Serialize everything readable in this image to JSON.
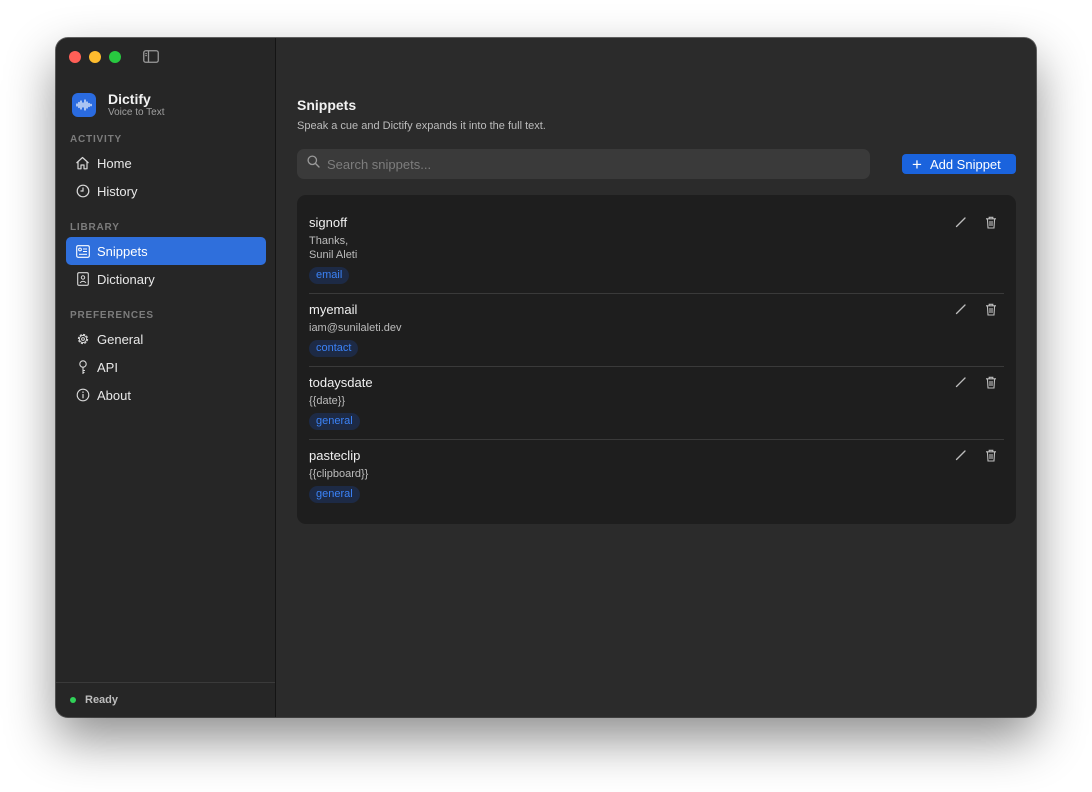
{
  "app": {
    "name": "Dictify",
    "tagline": "Voice to Text"
  },
  "sidebar": {
    "sections": [
      {
        "label": "ACTIVITY",
        "items": [
          {
            "label": "Home",
            "icon": "house-icon"
          },
          {
            "label": "History",
            "icon": "clock-icon"
          }
        ]
      },
      {
        "label": "LIBRARY",
        "items": [
          {
            "label": "Snippets",
            "icon": "snippets-icon",
            "active": true
          },
          {
            "label": "Dictionary",
            "icon": "book-icon"
          }
        ]
      },
      {
        "label": "PREFERENCES",
        "items": [
          {
            "label": "General",
            "icon": "gear-icon"
          },
          {
            "label": "API",
            "icon": "key-icon"
          },
          {
            "label": "About",
            "icon": "info-icon"
          }
        ]
      }
    ],
    "status": "Ready"
  },
  "main": {
    "title": "Snippets",
    "subtitle": "Speak a cue and Dictify expands it into the full text.",
    "search_placeholder": "Search snippets...",
    "add_label": "Add Snippet",
    "snippets": [
      {
        "name": "signoff",
        "text": "Thanks,\nSunil Aleti",
        "tag": "email"
      },
      {
        "name": "myemail",
        "text": "iam@sunilaleti.dev",
        "tag": "contact"
      },
      {
        "name": "todaysdate",
        "text": "{{date}}",
        "tag": "general"
      },
      {
        "name": "pasteclip",
        "text": "{{clipboard}}",
        "tag": "general"
      }
    ]
  },
  "colors": {
    "accent": "#2f6fdc",
    "button": "#1a63dd",
    "status": "#30d158",
    "tag_text": "#3b82f6"
  }
}
